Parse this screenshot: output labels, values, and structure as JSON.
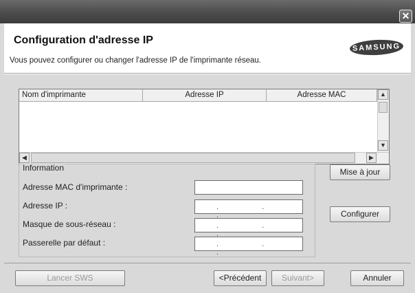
{
  "header": {
    "title": "Configuration d'adresse IP",
    "subtitle": "Vous pouvez configurer ou changer l'adresse IP de l'imprimante réseau.",
    "brand_logo": "SAMSUNG"
  },
  "window": {
    "close_glyph": "✕"
  },
  "table": {
    "columns": [
      "Nom d'imprimante",
      "Adresse IP",
      "Adresse MAC"
    ],
    "rows": []
  },
  "info": {
    "legend": "Information",
    "mac_label": "Adresse MAC d'imprimante :",
    "ip_label": "Adresse IP :",
    "subnet_label": "Masque de sous-réseau :",
    "gateway_label": "Passerelle par défaut :",
    "ip_value": ". . .",
    "subnet_value": ". . .",
    "gateway_value": ". . ."
  },
  "buttons": {
    "update": "Mise à jour",
    "configure": "Configurer",
    "launch_sws": "Lancer SWS",
    "previous": "<Précédent",
    "next": "Suivant>",
    "cancel": "Annuler"
  },
  "icons": {
    "up": "▲",
    "down": "▼",
    "left": "◀",
    "right": "▶"
  }
}
